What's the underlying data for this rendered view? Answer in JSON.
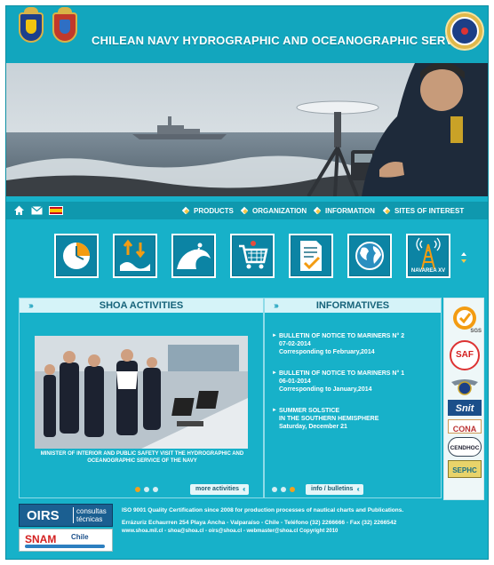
{
  "header": {
    "title": "CHILEAN NAVY HYDROGRAPHIC AND OCEANOGRAPHIC SERVICE"
  },
  "nav": {
    "utility_icons": [
      "home-icon",
      "mail-icon",
      "spain-flag-icon"
    ],
    "items": [
      {
        "label": "PRODUCTS"
      },
      {
        "label": "ORGANIZATION"
      },
      {
        "label": "INFORMATION"
      },
      {
        "label": "SITES OF INTEREST"
      }
    ]
  },
  "quick_links": {
    "icons": [
      "clock-icon",
      "tide-icon",
      "wave-icon",
      "cart-icon",
      "document-check-icon",
      "globe-icon",
      "radio-tower-icon"
    ],
    "navarea_label": "NAVAREA XV"
  },
  "activities": {
    "title": "SHOA ACTIVITIES",
    "caption": "MINISTER OF INTERIOR AND PUBLIC SAFETY VISIT THE HYDROGRAPHIC AND OCEANOGRAPHIC SERVICE OF THE NAVY",
    "more_label": "more activities",
    "pager_active": 1,
    "pager_count": 3
  },
  "informatives": {
    "title": "INFORMATIVES",
    "items": [
      {
        "title": "BULLETIN OF NOTICE TO MARINERS N° 2",
        "date": "07-02-2014",
        "note": "Corresponding to February,2014"
      },
      {
        "title": "BULLETIN OF NOTICE TO MARINERS N° 1",
        "date": "06-01-2014",
        "note": "Corresponding to January,2014"
      },
      {
        "title": "SUMMER SOLSTICE",
        "date": "IN THE SOUTHERN HEMISPHERE",
        "note": "Saturday, December 21"
      }
    ],
    "bulletins_label": "info / bulletins",
    "pager_active": 3,
    "pager_count": 3
  },
  "badges": {
    "sgs": "SGS",
    "saf": "SAF",
    "snit": "Snit",
    "cona": "CONA",
    "cendhoc": "CENDHOC",
    "sephc": "SEPHC"
  },
  "footer": {
    "oirs_big": "OIRS",
    "oirs_small_1": "consultas",
    "oirs_small_2": "técnicas",
    "snam_1": "SNAM",
    "snam_2": "Chile",
    "certification": "ISO 9001 Quality Certification since 2008 for production processes of nautical charts and Publications.",
    "address": "Errázuriz Echaurren 254 Playa Ancha - Valparaíso - Chile - Teléfono (32) 2266666 - Fax (32) 2266542",
    "links": "www.shoa.mil.cl - shoa@shoa.cl - oirs@shoa.cl - webmaster@shoa.cl Copyright 2010"
  }
}
